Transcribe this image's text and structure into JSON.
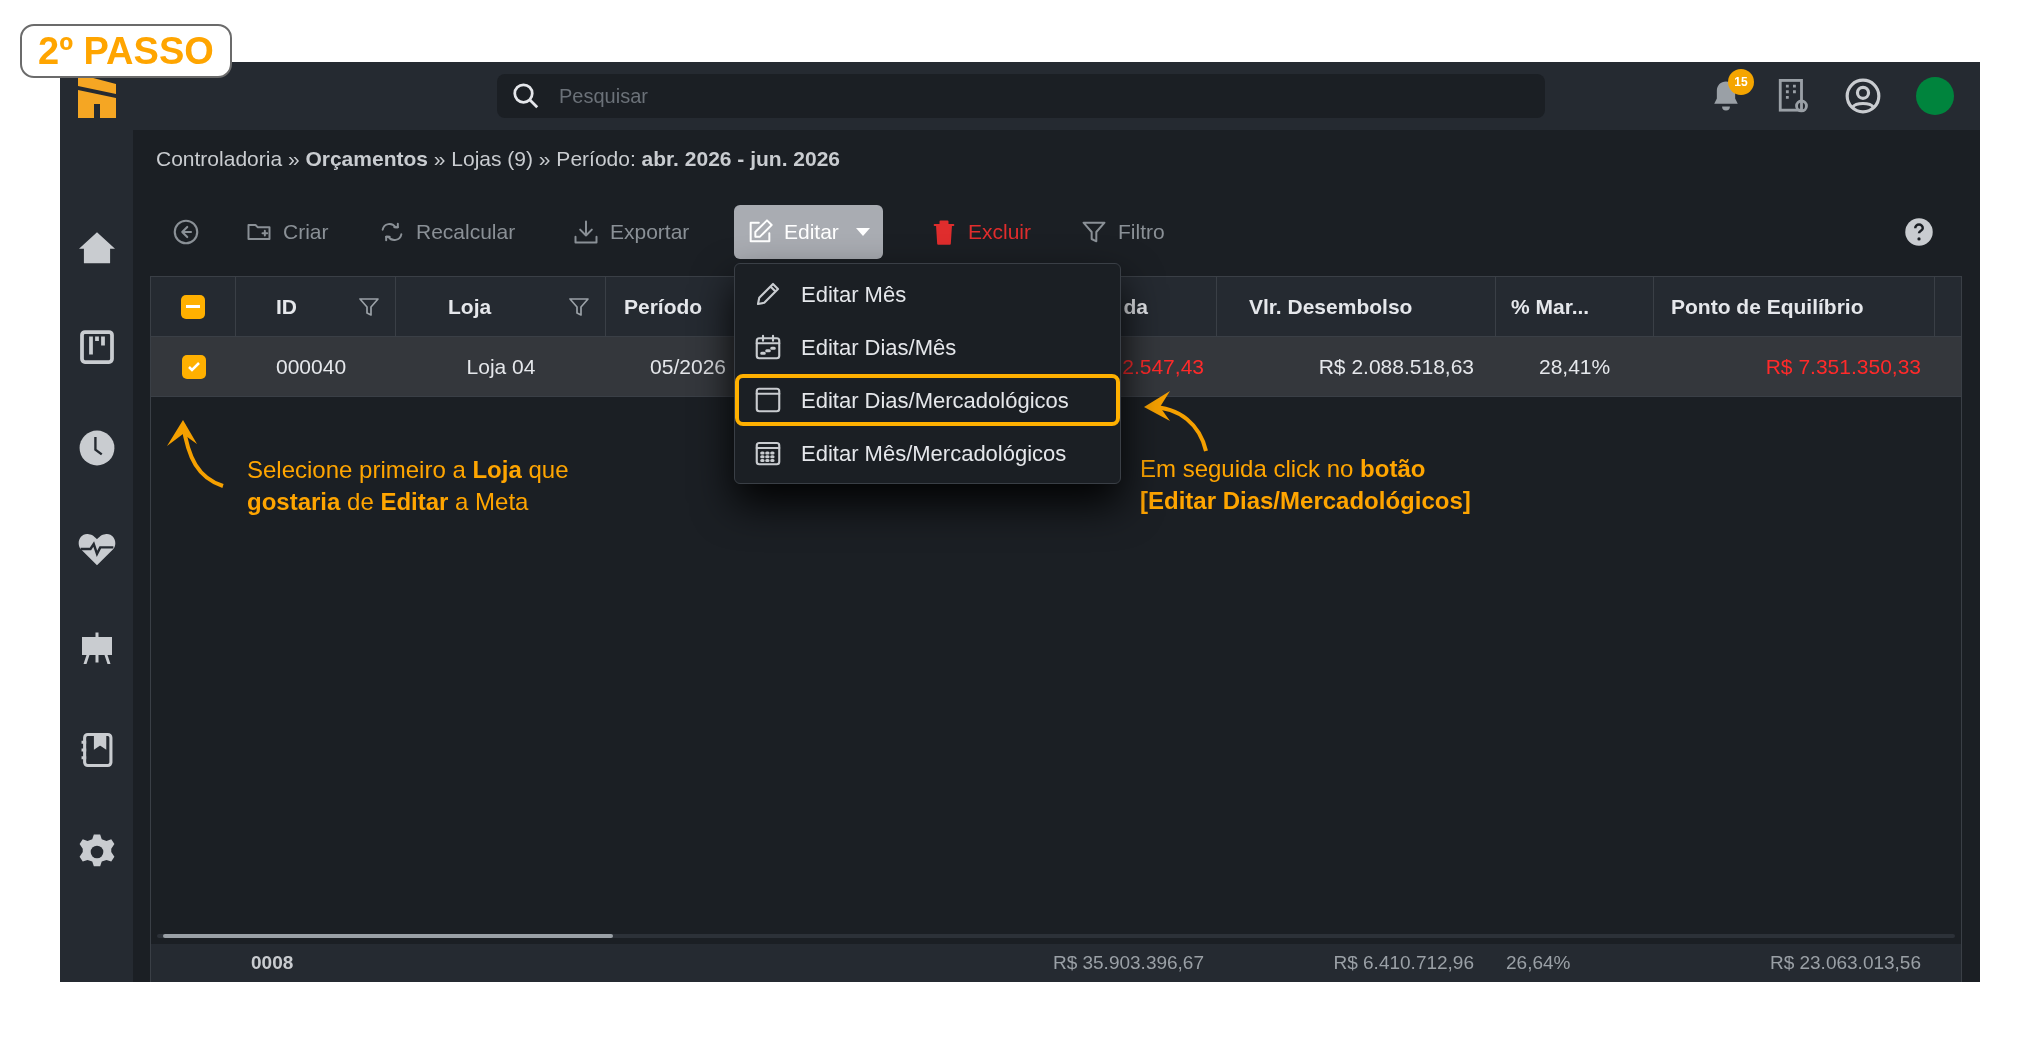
{
  "badge": "2º PASSO",
  "search": {
    "placeholder": "Pesquisar"
  },
  "notifications": {
    "count": "15"
  },
  "breadcrumb": "Controladoria » **Orçamentos** » Lojas (9) » Período: **abr. 2026 - jun. 2026**",
  "toolbar": [
    {
      "kind": "back"
    },
    {
      "label": "Criar",
      "kind": "plain"
    },
    {
      "label": "Recalcular",
      "kind": "plain"
    },
    {
      "label": "Exportar",
      "kind": "plain"
    },
    {
      "label": "Editar",
      "kind": "dropdown",
      "expanded": true
    },
    {
      "label": "Excluir",
      "kind": "danger"
    },
    {
      "label": "Filtro",
      "kind": "plain"
    }
  ],
  "menu": [
    {
      "label": "Editar Mês",
      "highlighted": false
    },
    {
      "label": "Editar Dias/Mês",
      "highlighted": false
    },
    {
      "label": "Editar Dias/Mercadológicos",
      "highlighted": true
    },
    {
      "label": "Editar Mês/Mercadológicos",
      "highlighted": false
    }
  ],
  "table": {
    "header_checkbox": {
      "indeterminate": true
    },
    "columns": [
      {
        "label": "ID",
        "filter": true
      },
      {
        "label": "Loja",
        "filter": true
      },
      {
        "label": "Período",
        "filter": false
      },
      {
        "label": "da",
        "filter": false
      },
      {
        "label": "Vlr. Desembolso",
        "filter": false
      },
      {
        "label": "% Mar...",
        "filter": false
      },
      {
        "label": "Ponto de Equilíbrio",
        "filter": false
      }
    ],
    "rows": [
      {
        "selected": true,
        "checked": true,
        "cells": [
          {
            "text": "000040",
            "negative": false
          },
          {
            "text": "Loja 04",
            "negative": false
          },
          {
            "text": "05/2026",
            "negative": false
          },
          {
            "text": "2.547,43",
            "negative": true
          },
          {
            "text": "R$ 2.088.518,63",
            "negative": false
          },
          {
            "text": "28,41%",
            "negative": false
          },
          {
            "text": "R$ 7.351.350,33",
            "negative": true
          }
        ]
      }
    ],
    "footer": {
      "count": "0008",
      "totals": [
        "R$ 35.903.396,67",
        "R$ 6.410.712,96",
        "26,64%",
        "R$ 23.063.013,56"
      ]
    }
  },
  "annotations": [
    {
      "text": "Selecione primeiro a **Loja** que\n**gostaria** de **Editar** a Meta"
    },
    {
      "text": "Em seguida click no **botão**\n**[Editar Dias/Mercadológicos]**"
    }
  ]
}
